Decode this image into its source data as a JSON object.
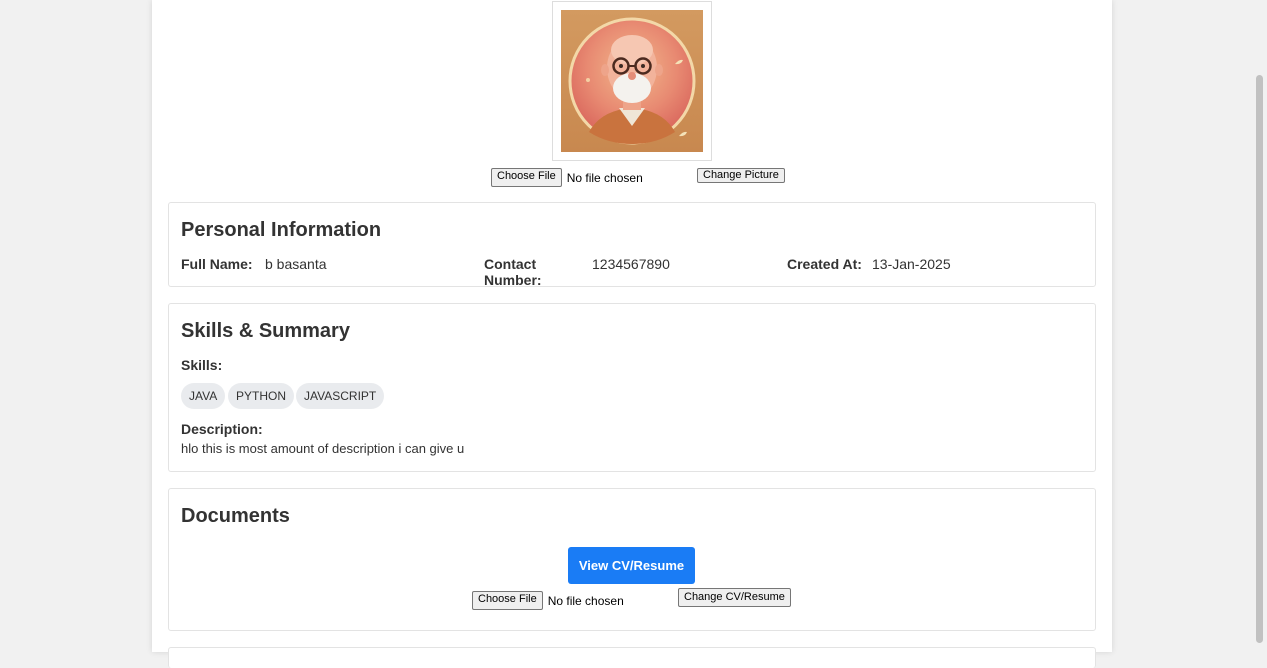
{
  "profile_picture": {
    "file_button_label": "Choose File",
    "file_status": "No file chosen",
    "change_button_label": "Change Picture"
  },
  "personal_info": {
    "title": "Personal Information",
    "full_name_label": "Full Name:",
    "full_name_value": "b basanta",
    "contact_label": "Contact Number:",
    "contact_value": "1234567890",
    "created_label": "Created At:",
    "created_value": "13-Jan-2025"
  },
  "skills_summary": {
    "title": "Skills & Summary",
    "skills_label": "Skills:",
    "skills": [
      "JAVA",
      "PYTHON",
      "JAVASCRIPT"
    ],
    "description_label": "Description:",
    "description_value": "hlo this is most amount of description i can give u"
  },
  "documents": {
    "title": "Documents",
    "view_button_label": "View CV/Resume",
    "file_button_label": "Choose File",
    "file_status": "No file chosen",
    "change_button_label": "Change CV/Resume"
  },
  "colors": {
    "accent": "#1a7cf5",
    "chip_bg": "#e9ebee",
    "page_bg": "#f1f1f1"
  }
}
